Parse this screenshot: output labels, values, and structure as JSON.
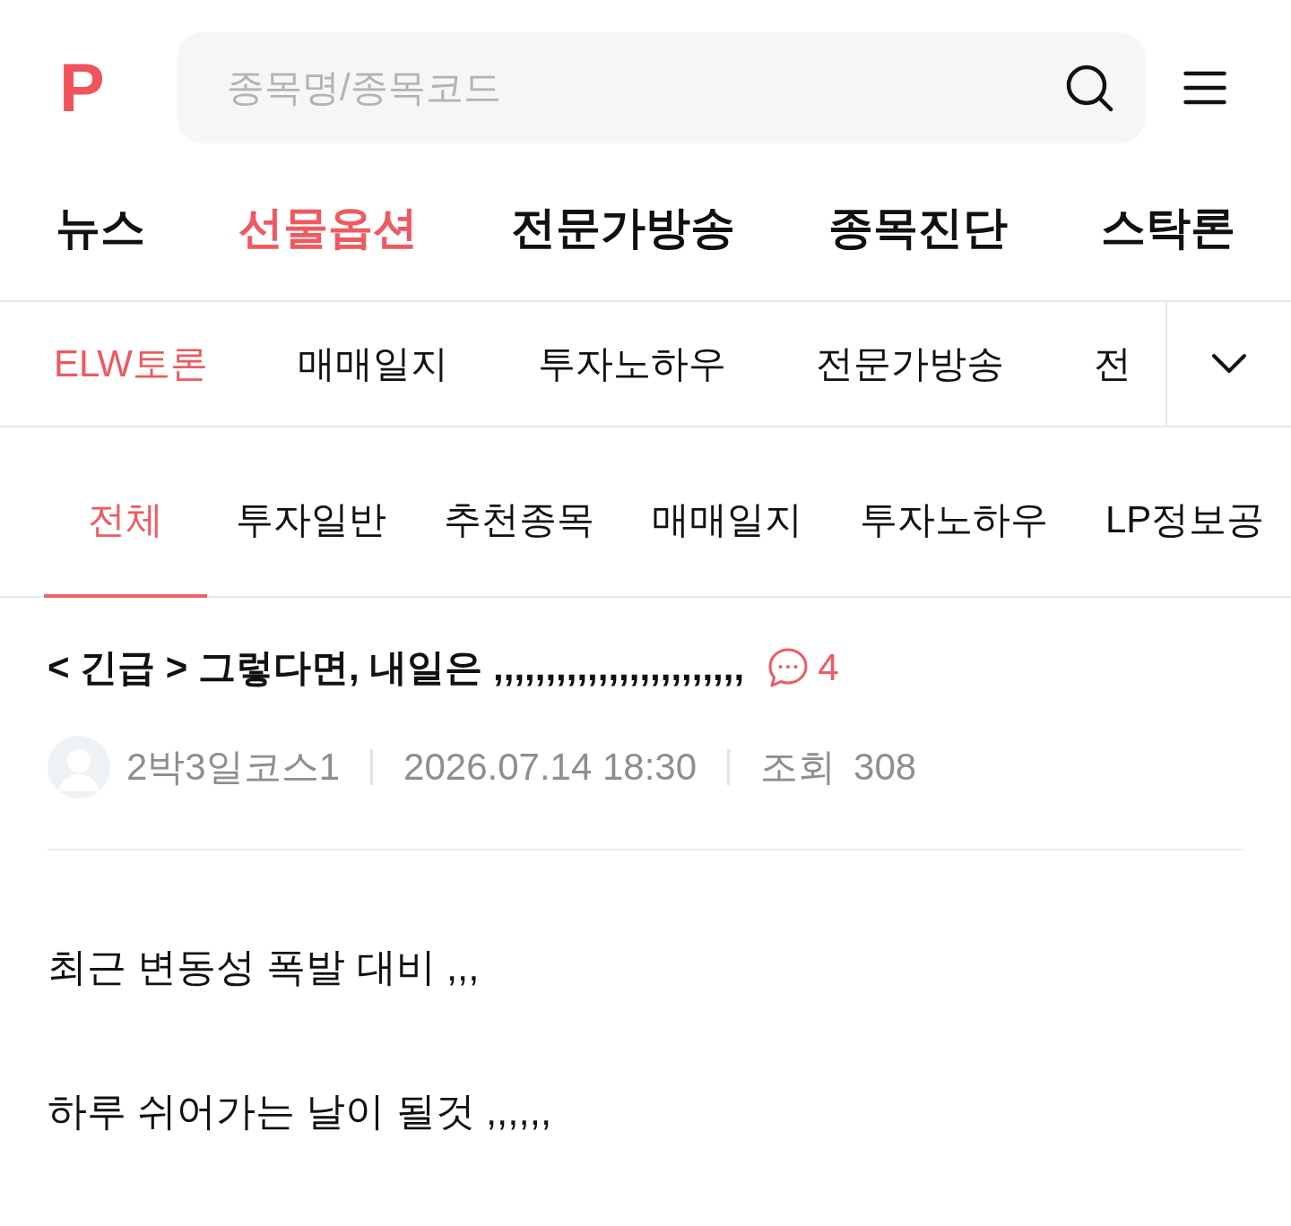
{
  "header": {
    "logo": "P",
    "search": {
      "placeholder": "종목명/종목코드"
    }
  },
  "main_nav": [
    {
      "label": "뉴스",
      "selected": false
    },
    {
      "label": "선물옵션",
      "selected": true
    },
    {
      "label": "전문가방송",
      "selected": false
    },
    {
      "label": "종목진단",
      "selected": false
    },
    {
      "label": "스탁론",
      "selected": false
    }
  ],
  "sub_nav": [
    {
      "label": "ELW토론",
      "selected": true
    },
    {
      "label": "매매일지",
      "selected": false
    },
    {
      "label": "투자노하우",
      "selected": false
    },
    {
      "label": "전문가방송",
      "selected": false
    },
    {
      "label": "전",
      "selected": false
    }
  ],
  "category_tabs": [
    {
      "label": "전체",
      "selected": true
    },
    {
      "label": "투자일반",
      "selected": false
    },
    {
      "label": "추천종목",
      "selected": false
    },
    {
      "label": "매매일지",
      "selected": false
    },
    {
      "label": "투자노하우",
      "selected": false
    },
    {
      "label": "LP정보공",
      "selected": false
    }
  ],
  "post": {
    "title": "< 긴급 > 그렇다면, 내일은 ,,,,,,,,,,,,,,,,,,,,,,,,",
    "comment_count": "4",
    "author": "2박3일코스1",
    "date": "2026.07.14 18:30",
    "views_label": "조회",
    "views": "308",
    "body": [
      "최근 변동성 폭발 대비 ,,,",
      "하루 쉬어가는 날이 될것 ,,,,,,"
    ]
  }
}
